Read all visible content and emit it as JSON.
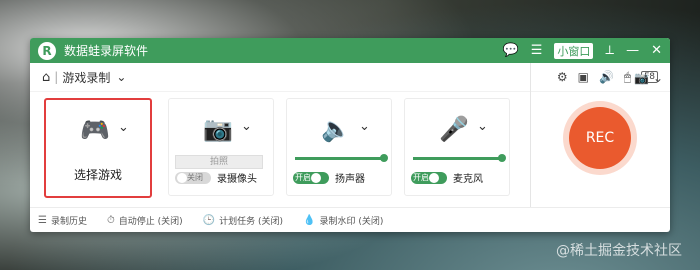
{
  "app": {
    "title": "数据蛙录屏软件",
    "mini_window": "小窗口"
  },
  "toolbar": {
    "mode": "游戏录制",
    "f_label": "F8"
  },
  "cards": {
    "game": {
      "label": "选择游戏"
    },
    "camera": {
      "photo": "拍照",
      "toggle_text": "关闭",
      "label": "录摄像头"
    },
    "speaker": {
      "toggle_text": "开启",
      "label": "扬声器",
      "level": 1
    },
    "mic": {
      "toggle_text": "开启",
      "label": "麦克风",
      "level": 1
    }
  },
  "rec": {
    "label": "REC"
  },
  "footer": {
    "history": "录制历史",
    "auto_stop": "自动停止 (关闭)",
    "schedule": "计划任务 (关闭)",
    "watermark": "录制水印 (关闭)"
  },
  "watermark_text": "@稀土掘金技术社区",
  "colors": {
    "brand": "#3f9c5c",
    "rec": "#ea5a2e",
    "selection": "#e23d3d"
  },
  "icons": [
    "home-icon",
    "settings-icon",
    "record-area-icon",
    "speaker-icon",
    "mouse-icon",
    "camera-icon",
    "gamepad-icon",
    "webcam-icon",
    "microphone-icon",
    "list-icon",
    "timer-icon",
    "schedule-icon",
    "watermark-icon"
  ]
}
